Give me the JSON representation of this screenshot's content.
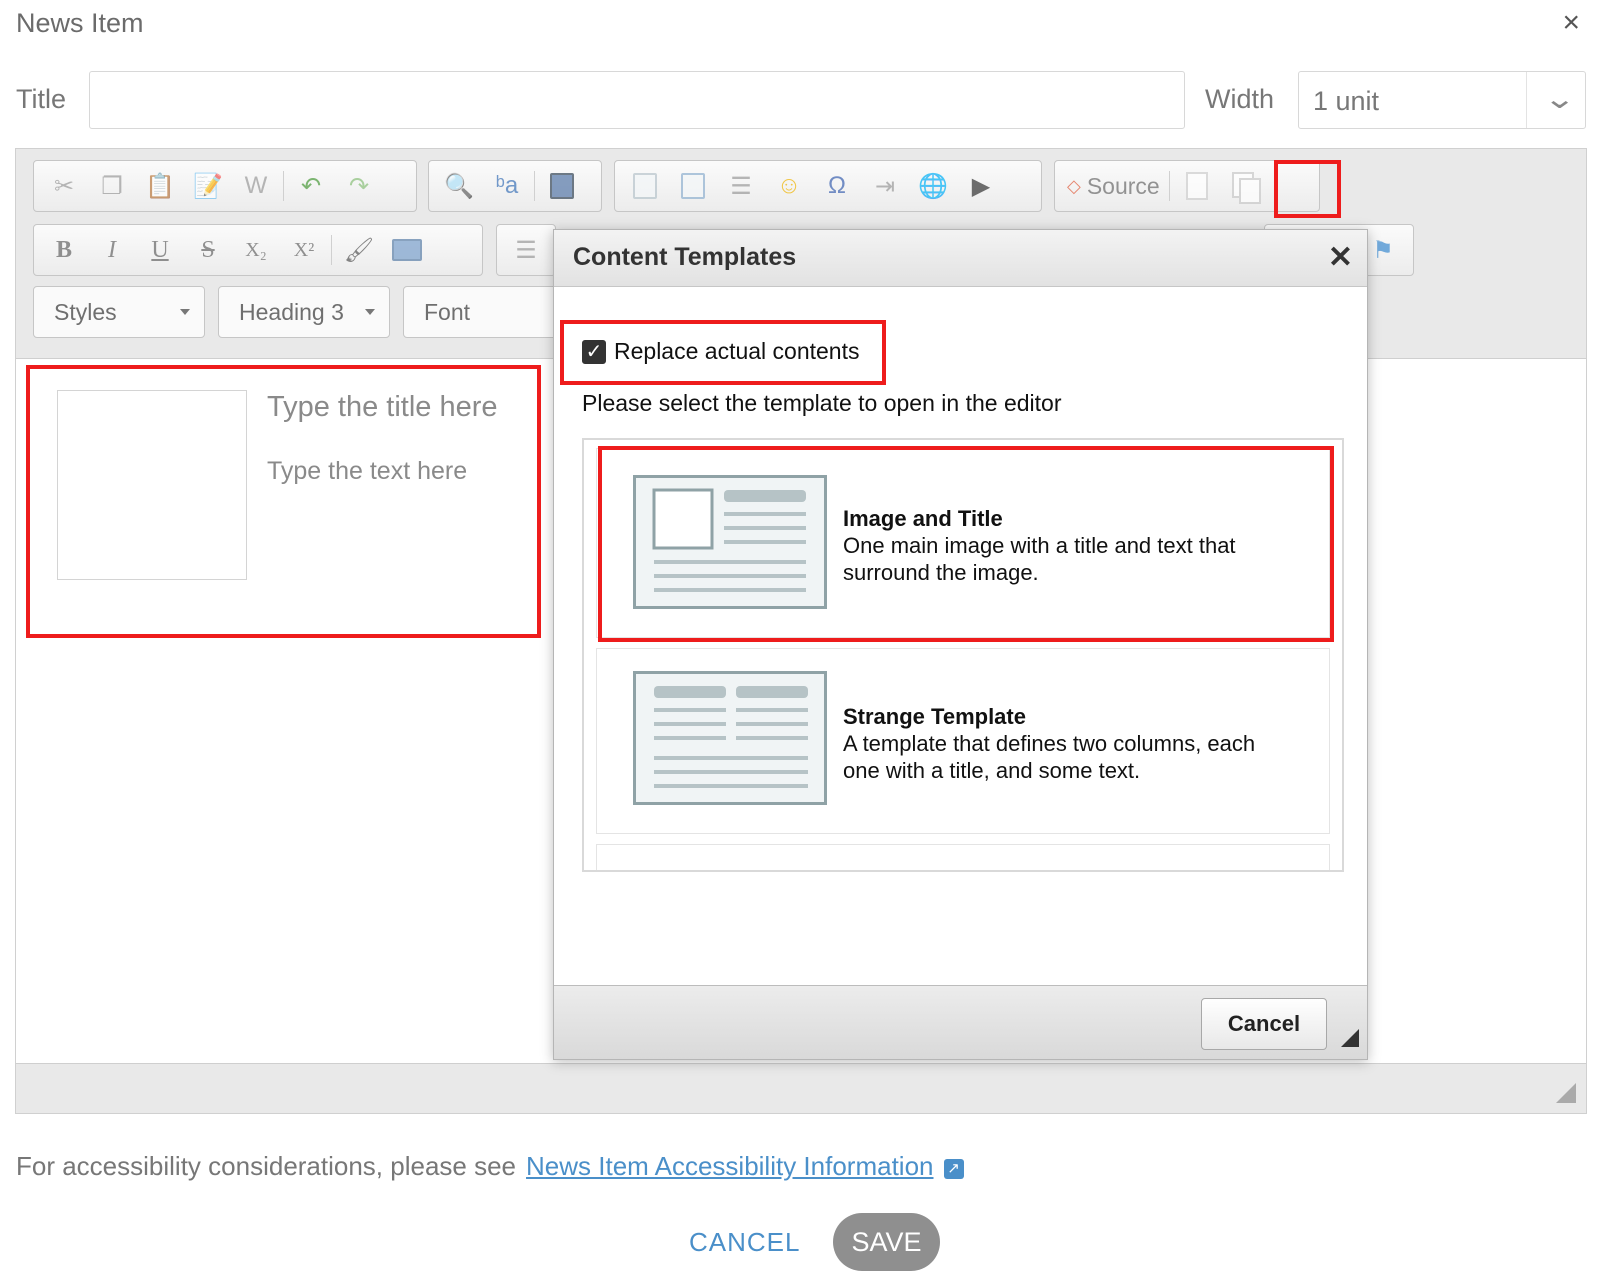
{
  "dialog": {
    "title": "News Item",
    "close_symbol": "×"
  },
  "form": {
    "title_label": "Title",
    "title_value": "",
    "width_label": "Width",
    "width_value": "1 unit"
  },
  "toolbar": {
    "source_label": "Source",
    "styles_label": "Styles",
    "format_label": "Heading 3",
    "font_label": "Font"
  },
  "editor_content": {
    "title_placeholder": "Type the title here",
    "text_placeholder": "Type the text here"
  },
  "templates_dialog": {
    "title": "Content Templates",
    "close_symbol": "✕",
    "replace_label": "Replace actual contents",
    "replace_checked": true,
    "instruction": "Please select the template to open in the editor",
    "templates": [
      {
        "name": "Image and Title",
        "description_line1": "One main image with a title and text that",
        "description_line2": "surround the image."
      },
      {
        "name": "Strange Template",
        "description_line1": "A template that defines two columns, each",
        "description_line2": "one with a title, and some text."
      }
    ],
    "cancel_label": "Cancel"
  },
  "footer": {
    "accessibility_text": "For accessibility considerations, please see",
    "accessibility_link": "News Item Accessibility Information",
    "cancel_label": "CANCEL",
    "save_label": "SAVE"
  },
  "colors": {
    "highlight": "#ee1c1c",
    "link": "#4a8fc9",
    "save_button": "#8f8f8f"
  }
}
